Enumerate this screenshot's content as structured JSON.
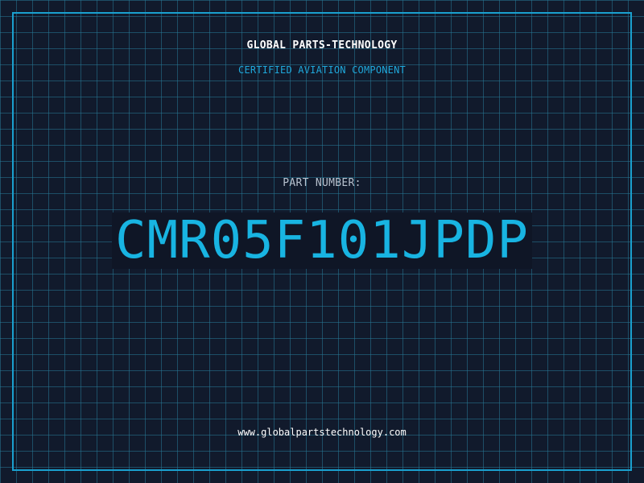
{
  "header": {
    "company": "GLOBAL PARTS-TECHNOLOGY",
    "tagline": "CERTIFIED AVIATION COMPONENT"
  },
  "part": {
    "label": "PART NUMBER:",
    "number": "CMR05F101JPDP"
  },
  "footer": {
    "website": "www.globalpartstechnology.com"
  },
  "colors": {
    "background": "#111a2c",
    "grid": "#26788f",
    "accent": "#18b4e2",
    "border": "#1aa0cf",
    "label": "#b8c2cf",
    "text": "#ffffff"
  }
}
